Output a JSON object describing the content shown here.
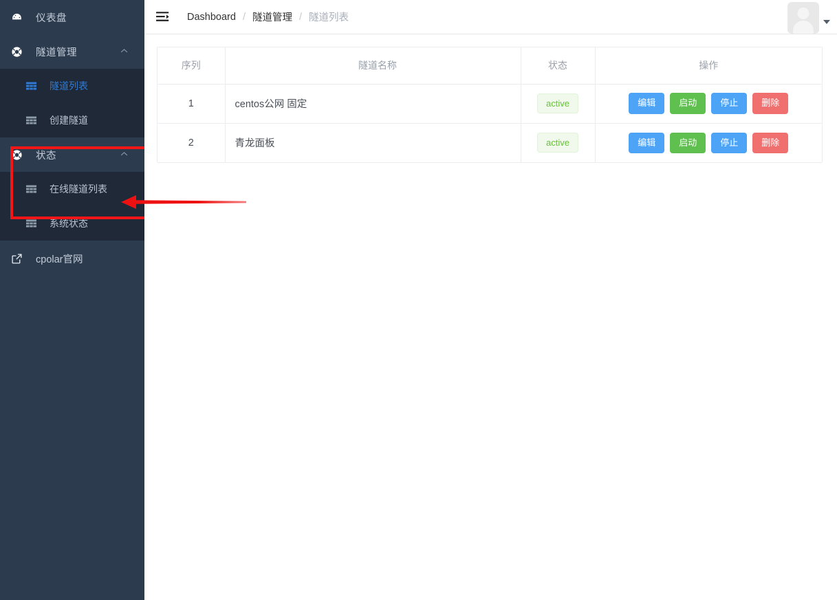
{
  "sidebar": {
    "items": [
      {
        "icon": "dashboard-gauge-icon",
        "label": "仪表盘",
        "type": "item"
      },
      {
        "icon": "life-ring-icon",
        "label": "隧道管理",
        "type": "group",
        "chevron": "⌃"
      },
      {
        "icon": "table-grid-icon",
        "label": "隧道列表",
        "type": "sub",
        "active": true
      },
      {
        "icon": "table-grid-icon",
        "label": "创建隧道",
        "type": "sub",
        "active": false
      },
      {
        "icon": "life-ring-icon",
        "label": "状态",
        "type": "group",
        "chevron": "⌃"
      },
      {
        "icon": "table-grid-icon",
        "label": "在线隧道列表",
        "type": "sub",
        "active": false
      },
      {
        "icon": "table-grid-icon",
        "label": "系统状态",
        "type": "sub",
        "active": false
      },
      {
        "icon": "external-link-icon",
        "label": "cpolar官网",
        "type": "external"
      }
    ]
  },
  "topbar": {
    "menu_toggle_icon": "hamburger-indent-icon",
    "breadcrumb": [
      {
        "label": "Dashboard",
        "current": false
      },
      {
        "label": "隧道管理",
        "current": false
      },
      {
        "label": "隧道列表",
        "current": true
      }
    ],
    "breadcrumb_separator": "/",
    "avatar_icon": "user-avatar-placeholder",
    "caret_icon": "chevron-down-icon"
  },
  "table": {
    "headers": {
      "index": "序列",
      "name": "隧道名称",
      "status": "状态",
      "operations": "操作"
    },
    "rows": [
      {
        "index": "1",
        "name": "centos公网 固定",
        "status": "active",
        "buttons": {
          "edit": "编辑",
          "start": "启动",
          "stop": "停止",
          "delete": "删除"
        }
      },
      {
        "index": "2",
        "name": "青龙面板",
        "status": "active",
        "buttons": {
          "edit": "编辑",
          "start": "启动",
          "stop": "停止",
          "delete": "删除"
        }
      }
    ]
  },
  "annotations": {
    "highlight_box_color": "#f41616",
    "arrow_color": "#ee1111",
    "arrow_points_to": "在线隧道列表"
  },
  "colors": {
    "sidebar_bg": "#2c3b4e",
    "submenu_bg": "#1f2937",
    "accent_blue": "#4da3f5",
    "accent_green": "#5fbf4f",
    "accent_red": "#f07070",
    "status_green": "#67c23a"
  }
}
